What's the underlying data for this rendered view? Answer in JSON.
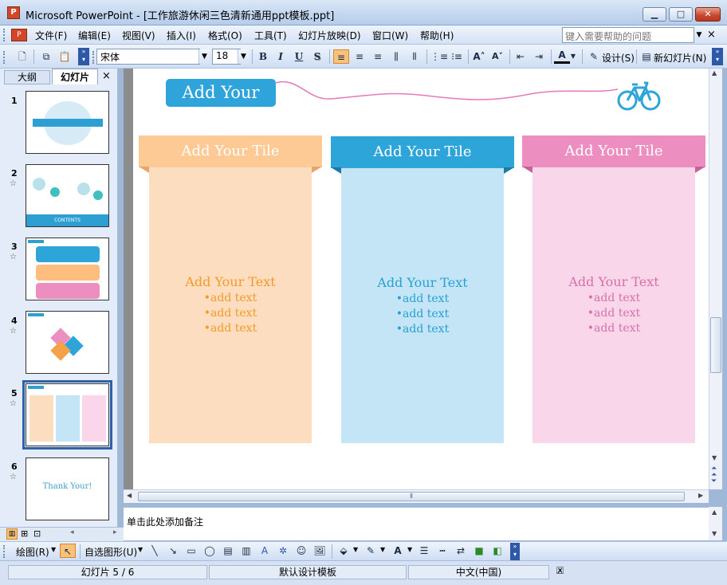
{
  "window": {
    "title": "Microsoft PowerPoint - [工作旅游休闲三色清新通用ppt模板.ppt]",
    "app_icon": "P",
    "minimize": "▁",
    "maximize": "□",
    "close": "✕"
  },
  "menu": {
    "items": [
      "文件(F)",
      "编辑(E)",
      "视图(V)",
      "插入(I)",
      "格式(O)",
      "工具(T)",
      "幻灯片放映(D)",
      "窗口(W)",
      "帮助(H)"
    ],
    "help_placeholder": "键入需要帮助的问题",
    "close": "×"
  },
  "toolbar": {
    "font_name": "宋体",
    "font_size": "18",
    "bold": "B",
    "italic": "I",
    "underline": "U",
    "shadow": "S",
    "font_color": "A",
    "design_label": "设计(S)",
    "new_slide_label": "新幻灯片(N)"
  },
  "left_panel": {
    "tab_outline": "大纲",
    "tab_slides": "幻灯片",
    "close": "×",
    "thumbnails": [
      {
        "num": "1",
        "star": ""
      },
      {
        "num": "2",
        "star": "☆",
        "caption": "CONTENTS"
      },
      {
        "num": "3",
        "star": "☆"
      },
      {
        "num": "4",
        "star": "☆"
      },
      {
        "num": "5",
        "star": "☆"
      },
      {
        "num": "6",
        "star": "☆",
        "caption": "Thank Your!"
      }
    ],
    "selected": 5
  },
  "slide": {
    "header_title": "Add Your Tile",
    "columns": [
      {
        "head": "Add Your Tile",
        "text": "Add Your Text",
        "bullets": [
          "•add text",
          "•add text",
          "•add text"
        ],
        "head_color": "#fdc995",
        "body_color": "#fdddc0",
        "text_color": "#f39a26"
      },
      {
        "head": "Add Your Tile",
        "text": "Add Your Text",
        "bullets": [
          "•add text",
          "•add text",
          "•add text"
        ],
        "head_color": "#2ea5d8",
        "body_color": "#c3e5f5",
        "text_color": "#27a0d2"
      },
      {
        "head": "Add Your Tile",
        "text": "Add Your Text",
        "bullets": [
          "•add text",
          "•add text",
          "•add text"
        ],
        "head_color": "#ec8fc0",
        "body_color": "#f9d6ea",
        "text_color": "#d571a8"
      }
    ],
    "colors": {
      "header_pill": "#2fa4da",
      "wave": "#e37aba",
      "bike": "#2ea5d8"
    }
  },
  "notes": {
    "placeholder": "单击此处添加备注"
  },
  "drawbar": {
    "draw_label": "绘图(R)",
    "autoshape_label": "自选图形(U)"
  },
  "status": {
    "slide_pos": "幻灯片 5 / 6",
    "template": "默认设计模板",
    "language": "中文(中国)"
  }
}
